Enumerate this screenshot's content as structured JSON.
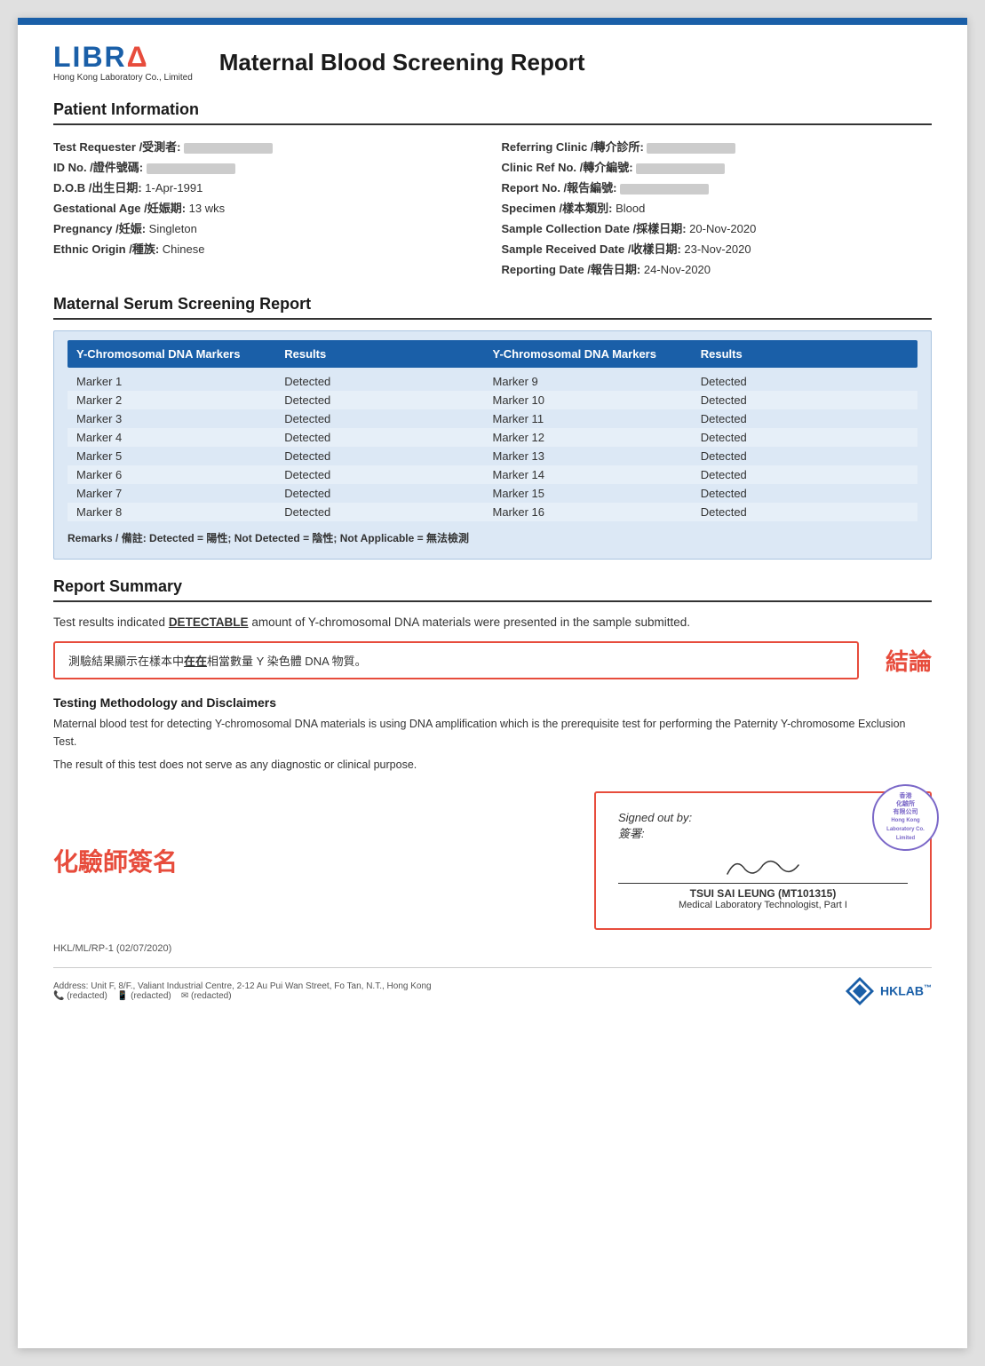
{
  "header": {
    "logo_text": "LIBRA",
    "logo_sub": "Hong Kong Laboratory Co., Limited",
    "report_title": "Maternal Blood Screening Report"
  },
  "patient_info": {
    "section_title": "Patient Information",
    "left_fields": [
      {
        "label": "Test Requester /受測者:",
        "value": "blurred"
      },
      {
        "label": "ID No. /證件號碼:",
        "value": "blurred"
      },
      {
        "label": "D.O.B /出生日期:",
        "value": "1-Apr-1991"
      },
      {
        "label": "Gestational Age /妊娠期:",
        "value": "13 wks"
      },
      {
        "label": "Pregnancy /妊娠:",
        "value": "Singleton"
      },
      {
        "label": "Ethnic Origin /種族:",
        "value": "Chinese"
      }
    ],
    "right_fields": [
      {
        "label": "Referring Clinic /轉介診所:",
        "value": "blurred"
      },
      {
        "label": "Clinic Ref No. /轉介編號:",
        "value": "blurred"
      },
      {
        "label": "Report No. /報告編號:",
        "value": "blurred"
      },
      {
        "label": "Specimen /樣本類別:",
        "value": "Blood"
      },
      {
        "label": "Sample Collection Date /採樣日期:",
        "value": "20-Nov-2020"
      },
      {
        "label": "Sample Received Date /收樣日期:",
        "value": "23-Nov-2020"
      },
      {
        "label": "Reporting Date /報告日期:",
        "value": "24-Nov-2020"
      }
    ]
  },
  "serum_report": {
    "section_title": "Maternal Serum Screening Report",
    "col1_header": "Y-Chromosomal DNA Markers",
    "col2_header": "Results",
    "col3_header": "Y-Chromosomal DNA Markers",
    "col4_header": "Results",
    "rows": [
      {
        "marker_left": "Marker 1",
        "result_left": "Detected",
        "marker_right": "Marker 9",
        "result_right": "Detected"
      },
      {
        "marker_left": "Marker 2",
        "result_left": "Detected",
        "marker_right": "Marker 10",
        "result_right": "Detected"
      },
      {
        "marker_left": "Marker 3",
        "result_left": "Detected",
        "marker_right": "Marker 11",
        "result_right": "Detected"
      },
      {
        "marker_left": "Marker 4",
        "result_left": "Detected",
        "marker_right": "Marker 12",
        "result_right": "Detected"
      },
      {
        "marker_left": "Marker 5",
        "result_left": "Detected",
        "marker_right": "Marker 13",
        "result_right": "Detected"
      },
      {
        "marker_left": "Marker 6",
        "result_left": "Detected",
        "marker_right": "Marker 14",
        "result_right": "Detected"
      },
      {
        "marker_left": "Marker 7",
        "result_left": "Detected",
        "marker_right": "Marker 15",
        "result_right": "Detected"
      },
      {
        "marker_left": "Marker 8",
        "result_left": "Detected",
        "marker_right": "Marker 16",
        "result_right": "Detected"
      }
    ],
    "remarks": "Remarks / 備註: Detected = 陽性; Not Detected = 陰性; Not Applicable = 無法檢測"
  },
  "report_summary": {
    "section_title": "Report Summary",
    "summary_line1": "Test results indicated ",
    "detectable_word": "DETECTABLE",
    "summary_line2": " amount of Y-chromosomal DNA materials were presented in the sample",
    "summary_line3": "submitted.",
    "chinese_result_line": "測驗結果顯示在樣本中",
    "chinese_underline": "在在",
    "chinese_result_line2": "相當數量 Y 染色體 DNA 物質。",
    "conclusion_label": "結論"
  },
  "methodology": {
    "title": "Testing Methodology and Disclaimers",
    "text1": "Maternal blood test for detecting Y-chromosomal DNA materials is using DNA amplification which is the prerequisite test",
    "text2": "for performing the Paternity Y-chromosome Exclusion Test.",
    "text3": "The result of this test does not serve as any diagnostic or clinical purpose."
  },
  "signature": {
    "chemist_label": "化驗師簽名",
    "signed_out_by": "Signed out by:",
    "signed_by_chinese": "簽署:",
    "signer_name": "TSUI SAI LEUNG (MT101315)",
    "signer_title": "Medical Laboratory Technologist, Part I",
    "stamp_text": "香港\n化驗所\n有限公司\nHong Kong\nLaboratory Co.\nLimited"
  },
  "footer": {
    "doc_number": "HKL/ML/RP-1 (02/07/2020)",
    "address": "Address: Unit F, 8/F., Valiant Industrial Centre, 2-12 Au Pui Wan Street, Fo Tan, N.T., Hong Kong",
    "contact_phones": "電話: (info redacted)   傳真: (info redacted)   電郵: (info redacted)",
    "hklab_label": "HKLAB"
  }
}
